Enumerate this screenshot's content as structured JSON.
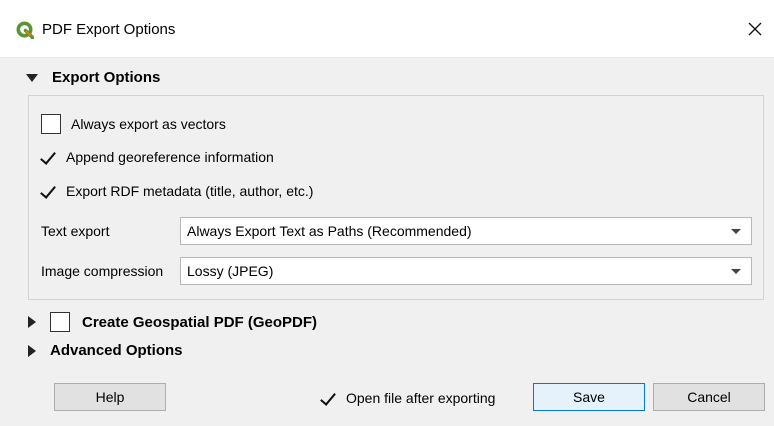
{
  "window": {
    "title": "PDF Export Options",
    "icon": "qgis-icon",
    "close_icon": "close-icon"
  },
  "export_options": {
    "header": "Export Options",
    "expanded": true,
    "checkboxes": [
      {
        "label": "Always export as vectors",
        "checked": false
      },
      {
        "label": "Append georeference information",
        "checked": true
      },
      {
        "label": "Export RDF metadata (title, author, etc.)",
        "checked": true
      }
    ],
    "text_export": {
      "label": "Text export",
      "value": "Always Export Text as Paths (Recommended)"
    },
    "image_compression": {
      "label": "Image compression",
      "value": "Lossy (JPEG)"
    }
  },
  "geopdf": {
    "header": "Create Geospatial PDF (GeoPDF)",
    "checked": false,
    "expanded": false
  },
  "advanced": {
    "header": "Advanced Options",
    "expanded": false
  },
  "footer": {
    "help_label": "Help",
    "open_after_label": "Open file after exporting",
    "open_after_checked": true,
    "save_label": "Save",
    "cancel_label": "Cancel"
  },
  "colors": {
    "title_bg": "#ffffff",
    "dialog_bg": "#f0f0f0",
    "qgis_green": "#589632",
    "qgis_yellow": "#ee7913",
    "default_button_border": "#0078d7"
  }
}
